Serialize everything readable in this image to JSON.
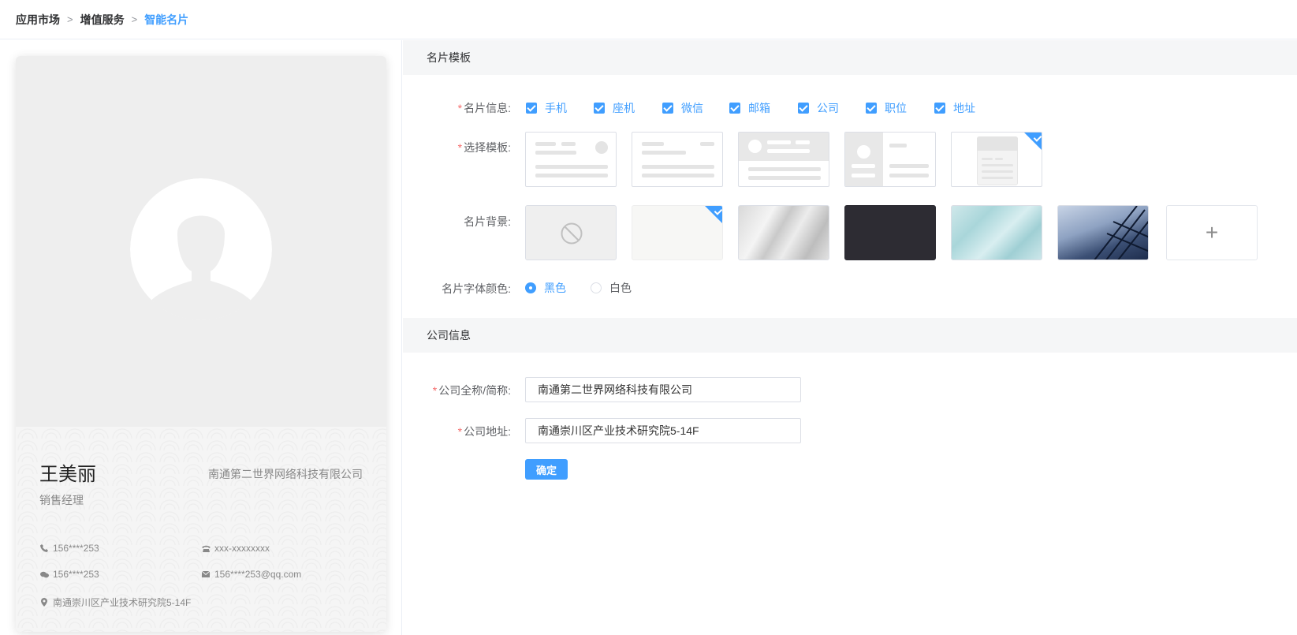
{
  "breadcrumb": [
    "应用市场",
    "增值服务",
    "智能名片"
  ],
  "card": {
    "name": "王美丽",
    "company": "南通第二世界网络科技有限公司",
    "title": "销售经理",
    "phone": "156****253",
    "landline": "xxx-xxxxxxxx",
    "wechat": "156****253",
    "email": "156****253@qq.com",
    "address": "南通崇川区产业技术研究院5-14F"
  },
  "template_section": {
    "heading": "名片模板",
    "info_label": "名片信息:",
    "info_options": [
      "手机",
      "座机",
      "微信",
      "邮箱",
      "公司",
      "职位",
      "地址"
    ],
    "template_label": "选择模板:",
    "template_selected": 5,
    "background_label": "名片背景:",
    "background_selected": 2,
    "background_add_symbol": "+",
    "font_color_label": "名片字体颜色:",
    "font_color_options": [
      "黑色",
      "白色"
    ],
    "font_color_selected": "黑色"
  },
  "company_section": {
    "heading": "公司信息",
    "name_label": "公司全称/简称:",
    "name_value": "南通第二世界网络科技有限公司",
    "address_label": "公司地址:",
    "address_value": "南通崇川区产业技术研究院5-14F",
    "confirm_label": "确定"
  },
  "colors": {
    "accent": "#409eff",
    "required": "#f56c6c",
    "dark_bg": "#2d2c33"
  }
}
